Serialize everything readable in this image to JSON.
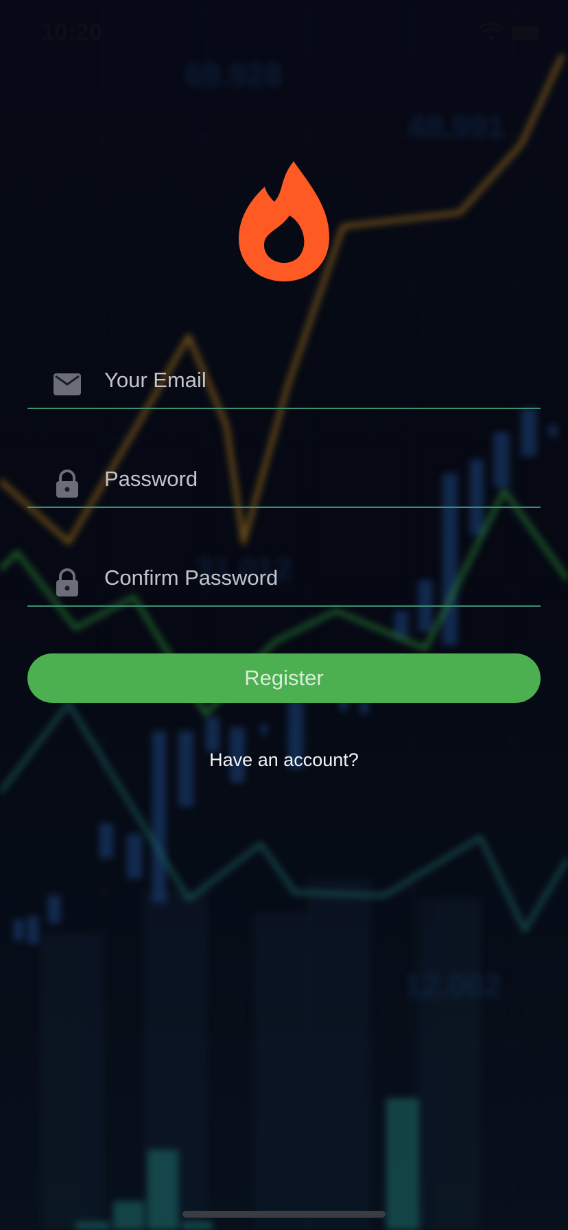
{
  "status_bar": {
    "time": "10:20",
    "icons": [
      "wifi-icon",
      "battery-icon"
    ]
  },
  "brand": {
    "logo_icon": "flame-icon",
    "logo_color": "#ff5a24"
  },
  "form": {
    "email": {
      "placeholder": "Your Email",
      "value": "",
      "icon": "mail-icon"
    },
    "password": {
      "placeholder": "Password",
      "value": "",
      "icon": "lock-icon"
    },
    "confirm_password": {
      "placeholder": "Confirm Password",
      "value": "",
      "icon": "lock-icon"
    },
    "underline_color": "#3d8f72"
  },
  "actions": {
    "register_label": "Register",
    "register_color": "#4caf50",
    "have_account_label": "Have an account?"
  },
  "background": {
    "visible_numbers": [
      "69.928",
      "48.991",
      "31.012",
      "12.002"
    ],
    "line_colors": [
      "#b07a1a",
      "#2f9a3a",
      "#1f6f6a"
    ],
    "bar_color": "#1e4a8a"
  }
}
